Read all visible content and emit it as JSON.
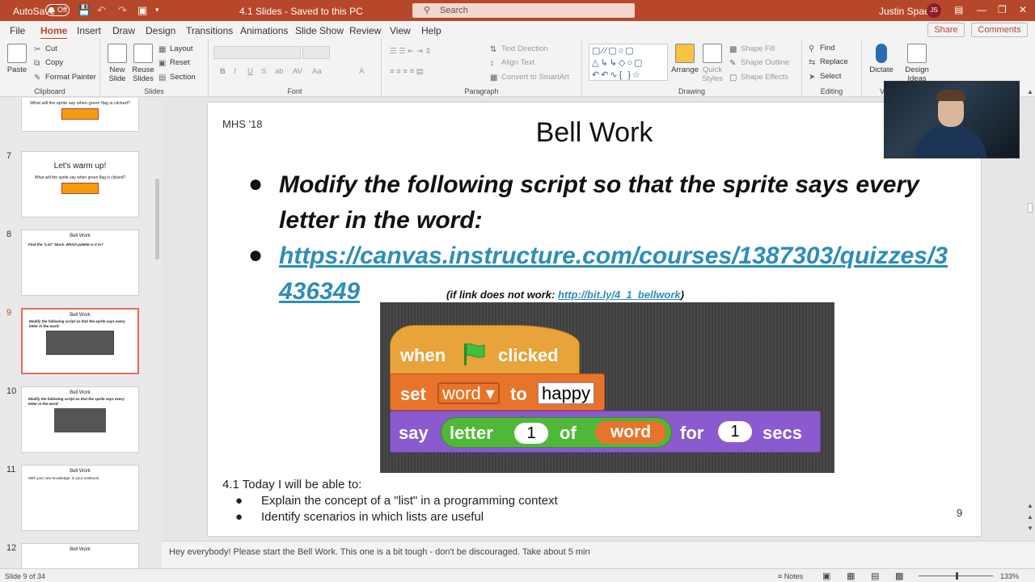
{
  "titlebar": {
    "autosave_label": "AutoSave",
    "autosave_state": "Off",
    "doc_title": "4.1 Slides - Saved to this PC",
    "search_placeholder": "Search",
    "user_name": "Justin Spaeth",
    "user_initials": "JS"
  },
  "menu": {
    "tabs": [
      "File",
      "Home",
      "Insert",
      "Draw",
      "Design",
      "Transitions",
      "Animations",
      "Slide Show",
      "Review",
      "View",
      "Help"
    ],
    "active": "Home",
    "share": "Share",
    "comments": "Comments"
  },
  "ribbon": {
    "clipboard": {
      "label": "Clipboard",
      "paste": "Paste",
      "cut": "Cut",
      "copy": "Copy",
      "format_painter": "Format Painter"
    },
    "slides": {
      "label": "Slides",
      "new_slide": "New Slide",
      "reuse_slides": "Reuse Slides",
      "layout": "Layout",
      "reset": "Reset",
      "section": "Section"
    },
    "font": {
      "label": "Font",
      "buttons": [
        "B",
        "I",
        "U",
        "S",
        "ab",
        "AV",
        "Aa",
        "A"
      ]
    },
    "paragraph": {
      "label": "Paragraph",
      "text_direction": "Text Direction",
      "align_text": "Align Text",
      "convert_smartart": "Convert to SmartArt"
    },
    "drawing": {
      "label": "Drawing",
      "arrange": "Arrange",
      "quick_styles": "Quick Styles",
      "shape_fill": "Shape Fill",
      "shape_outline": "Shape Outline",
      "shape_effects": "Shape Effects"
    },
    "editing": {
      "label": "Editing",
      "find": "Find",
      "replace": "Replace",
      "select": "Select"
    },
    "voice": {
      "label": "Voi",
      "dictate": "Dictate"
    },
    "designer": {
      "design_ideas": "Design Ideas"
    }
  },
  "thumbnails": [
    {
      "num": "",
      "title": "What will the sprite say when green flag is clicked?"
    },
    {
      "num": "7",
      "title": "Let's warm up!",
      "subtitle": "What will the sprite say when green flag is clicked?"
    },
    {
      "num": "8",
      "title": "Bell Work",
      "text": "Find the \"List\" block. Which palette is it in?"
    },
    {
      "num": "9",
      "title": "Bell Work",
      "text": "Modify the following script so that the sprite says every letter in the word:"
    },
    {
      "num": "10",
      "title": "Bell Work",
      "text": "Modify the following script so that the sprite says every letter in the word:"
    },
    {
      "num": "11",
      "title": "Bell Work",
      "text": "With your new knowledge, in your notebook."
    },
    {
      "num": "12",
      "title": "Bell Work"
    }
  ],
  "slide": {
    "header": "MHS '18",
    "title": "Bell Work",
    "bullet1": "Modify the following script so that the sprite says every letter in the word:",
    "bullet2_link": "https://canvas.instructure.com/courses/1387303/quizzes/3436349",
    "note_prefix": "(if link does not work: ",
    "note_link": "http://bit.ly/4_1_bellwork",
    "note_suffix": ")",
    "script": {
      "hat_when": "when",
      "hat_clicked": "clicked",
      "set": "set",
      "var": "word",
      "to": "to",
      "value": "happy",
      "say": "say",
      "letter": "letter",
      "index": "1",
      "of": "of",
      "word": "word",
      "for": "for",
      "secs_val": "1",
      "secs": "secs"
    },
    "objective_title": "4.1 Today I will be able to:",
    "objectives": [
      "Explain the concept of a \"list\" in a programming context",
      "Identify scenarios in which lists are useful"
    ],
    "page_number": "9"
  },
  "notes": "Hey everybody! Please start the Bell Work. This one is a bit tough - don't be discouraged. Take about 5 min",
  "status": {
    "slide_of": "Slide 9 of 34",
    "notes_btn": "Notes",
    "zoom": "133%"
  },
  "colors": {
    "accent": "#b7472a",
    "link": "#2e8db8",
    "hat": "#e8a33a",
    "set": "#e8732a",
    "say": "#8b5acf",
    "operator": "#4fb838"
  }
}
